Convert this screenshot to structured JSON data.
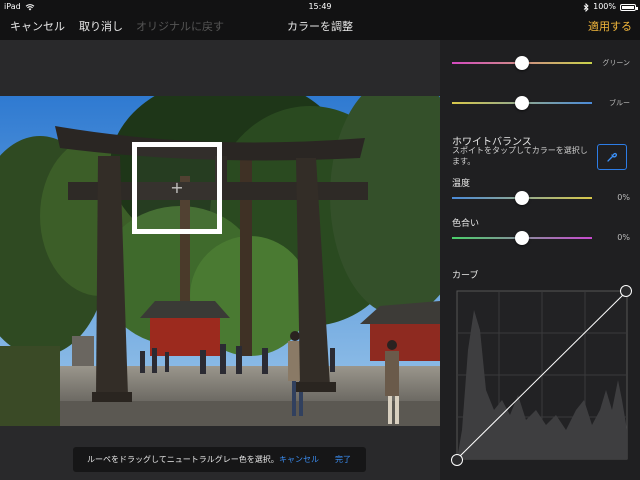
{
  "status": {
    "carrier": "iPad",
    "time": "15:49",
    "battery": "100%",
    "battery_level": 1.0
  },
  "toolbar": {
    "cancel": "キャンセル",
    "undo": "取り消し",
    "revert": "オリジナルに戻す",
    "title": "カラーを調整",
    "apply": "適用する"
  },
  "loupe_hint": {
    "text": "ルーペをドラッグしてニュートラルグレー色を選択。",
    "cancel": "キャンセル",
    "done": "完了"
  },
  "panel": {
    "green": {
      "label": "グリーン",
      "level": 0.5
    },
    "blue": {
      "label": "ブルー",
      "level": 0.5
    },
    "white_balance": {
      "title": "ホワイトバランス",
      "description": "スポイトをタップしてカラーを選択します。"
    },
    "temperature": {
      "label": "温度",
      "value": "0%",
      "level": 0.5
    },
    "tint": {
      "label": "色合い",
      "value": "0%",
      "level": 0.5
    },
    "curve": {
      "label": "カーブ"
    }
  },
  "colors": {
    "accent": "#3b8ff5",
    "apply": "#f2b73b"
  }
}
